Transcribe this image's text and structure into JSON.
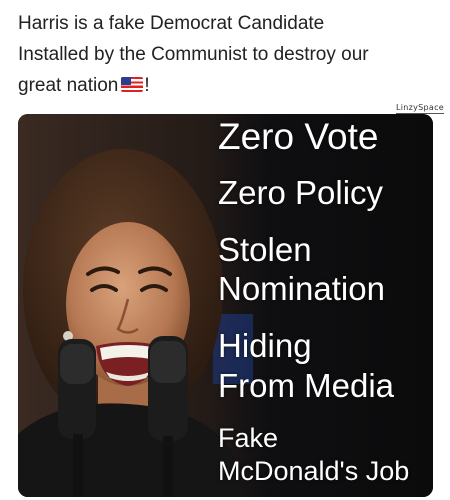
{
  "post": {
    "line1": "Harris is a fake Democrat Candidate",
    "line2": "Installed by the Communist to destroy our",
    "line3_text": "great nation",
    "line3_flag": "us-flag-icon",
    "line3_suffix": "!"
  },
  "watermark": "LinzySpace",
  "meme": {
    "lines": [
      "Zero Vote",
      "Zero Policy",
      "Stolen",
      "Nomination",
      "Hiding",
      "From Media",
      "Fake",
      "McDonald's Job"
    ]
  },
  "colors": {
    "meme_background": "#101010",
    "meme_text": "#ffffff",
    "post_text": "#222222"
  }
}
